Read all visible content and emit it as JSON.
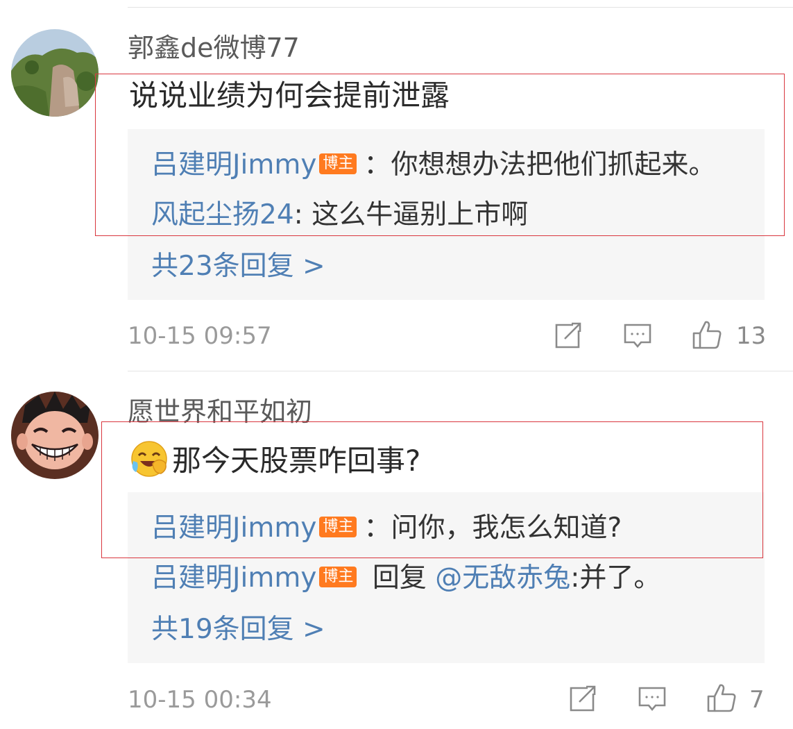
{
  "comments": [
    {
      "username": "郭鑫de微博77",
      "text": "说说业绩为何会提前泄露",
      "replies": [
        {
          "name": "吕建明Jimmy",
          "badge": "博主",
          "sep": "：",
          "text": "你想想办法把他们抓起来。"
        },
        {
          "name": "风起尘扬24",
          "sep": ": ",
          "text": "这么牛逼别上市啊"
        }
      ],
      "more_replies": "共23条回复 >",
      "timestamp": "10-15 09:57",
      "like_count": "13"
    },
    {
      "username": "愿世界和平如初",
      "text": "那今天股票咋回事?",
      "emoji": "laughing-crying-emoji",
      "replies": [
        {
          "name": "吕建明Jimmy",
          "badge": "博主",
          "sep": "：",
          "text": "问你，我怎么知道?"
        },
        {
          "name": "吕建明Jimmy",
          "badge": "博主",
          "sep": " 回复",
          "mention": "@无敌赤兔",
          "text": ":并了。"
        }
      ],
      "more_replies": "共19条回复 >",
      "timestamp": "10-15 00:34",
      "like_count": "7"
    }
  ],
  "icons": {
    "share": "share-icon",
    "comment": "comment-icon",
    "like": "thumbs-up-icon"
  },
  "colors": {
    "link_blue": "#4f7fb4",
    "badge_orange": "#ff7a1f",
    "highlight_red": "#d9363e"
  }
}
